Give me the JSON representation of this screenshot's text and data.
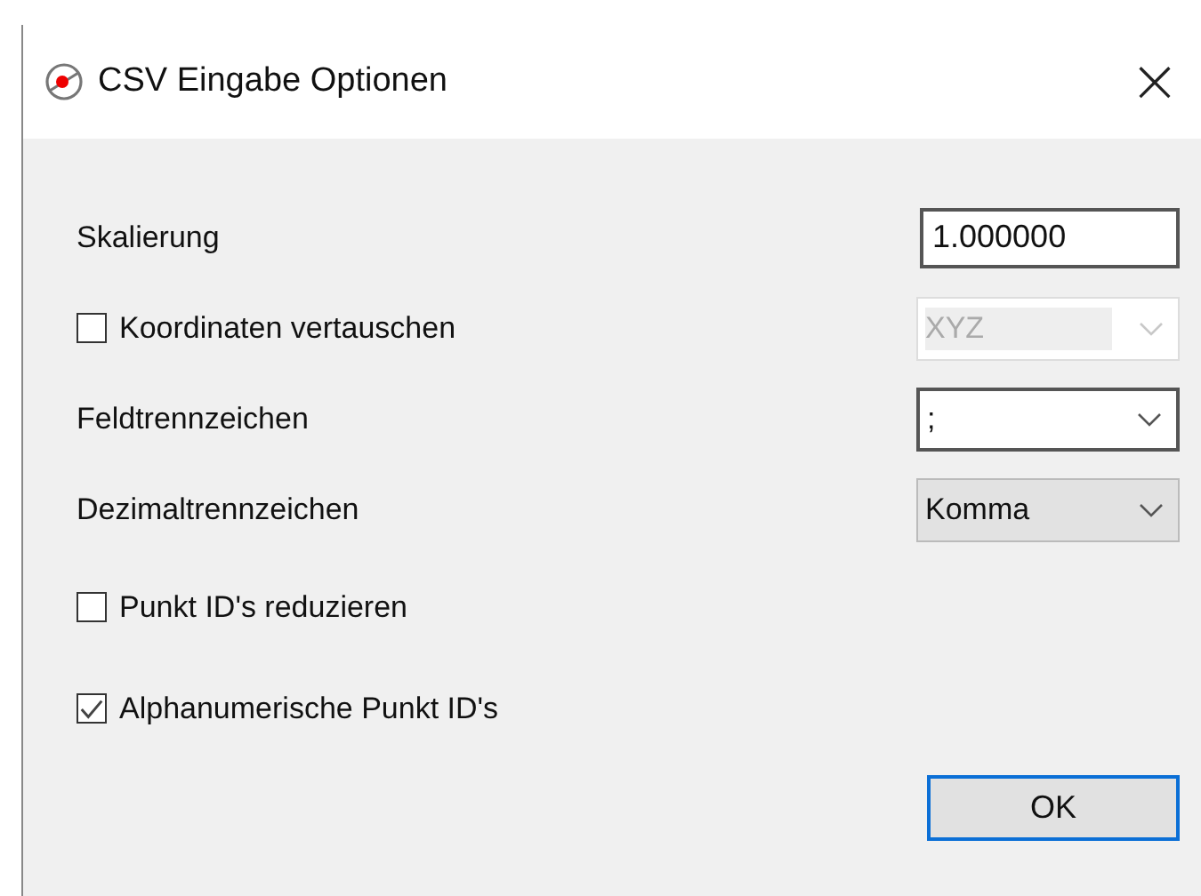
{
  "window": {
    "title": "CSV Eingabe Optionen",
    "close": "×"
  },
  "fields": [
    {
      "kind": "input",
      "label": "Skalierung",
      "value": "1.000000"
    },
    {
      "kind": "check-combo",
      "label": "Koordinaten vertauschen",
      "checked": false,
      "value": "XYZ",
      "disabled": true,
      "editable": true
    },
    {
      "kind": "combo",
      "label": "Feldtrennzeichen",
      "value": ";",
      "disabled": false,
      "editable": true
    },
    {
      "kind": "combo",
      "label": "Dezimaltrennzeichen",
      "value": "Komma",
      "disabled": false,
      "editable": false
    }
  ],
  "checkboxes": [
    {
      "label": "Punkt ID's reduzieren",
      "checked": false
    },
    {
      "label": "Alphanumerische Punkt ID's",
      "checked": true
    }
  ],
  "buttons": [
    "OK"
  ]
}
